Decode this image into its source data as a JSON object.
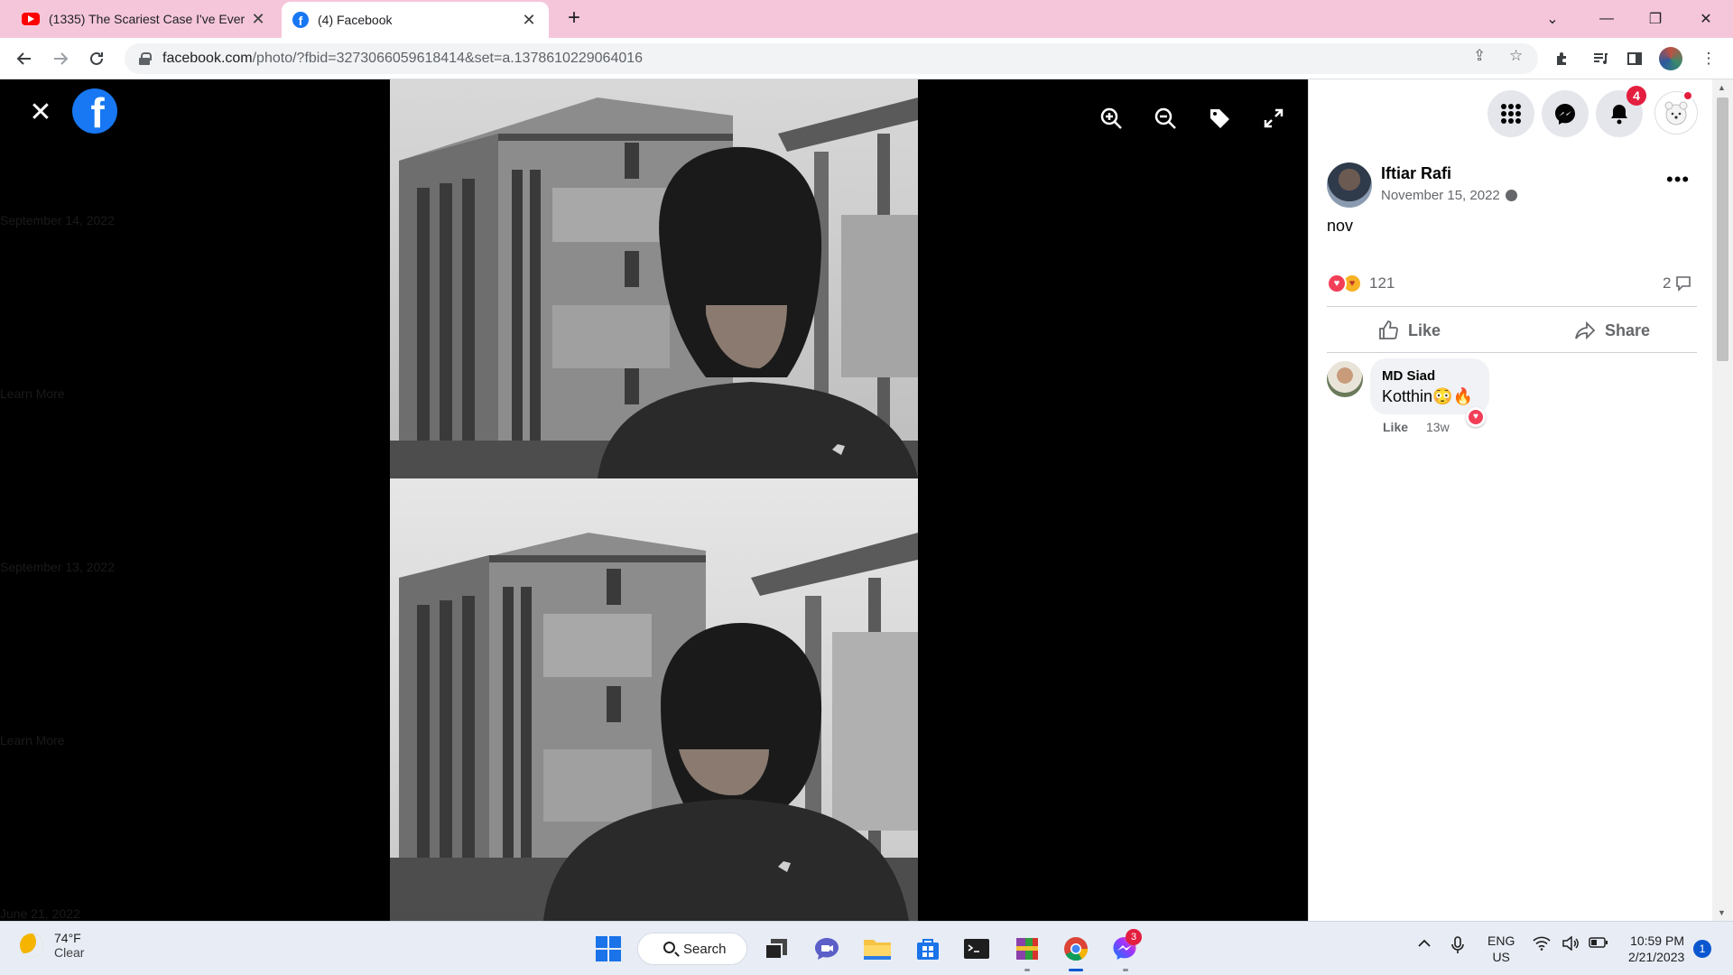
{
  "browser": {
    "tabs": [
      {
        "title": "(1335) The Scariest Case I've Ever Seen",
        "icon": "youtube-icon",
        "active": false
      },
      {
        "title": "(4) Facebook",
        "icon": "facebook-icon",
        "active": true
      }
    ],
    "url": {
      "domain": "facebook.com",
      "path": "/photo/?fbid=3273066059618414&set=a.1378610229064016"
    }
  },
  "viewer": {
    "sidebar_ghost": {
      "date_1": "September 14, 2022",
      "learn_1": "Learn More",
      "date_2": "September 13, 2022",
      "learn_2": "Learn More",
      "date_3": "June 21, 2022"
    },
    "tools": [
      "zoom-in-icon",
      "zoom-out-icon",
      "tag-icon",
      "fullscreen-icon"
    ]
  },
  "header": {
    "notification_count": "4"
  },
  "post": {
    "author": "Iftiar Rafi",
    "date": "November 15, 2022",
    "privacy": "globe-icon",
    "text": "nov",
    "reaction_count": "121",
    "comment_count": "2",
    "actions": {
      "like": "Like",
      "share": "Share"
    }
  },
  "comments": [
    {
      "author": "MD Siad",
      "text": "Kotthin😳🔥",
      "like_label": "Like",
      "time": "13w",
      "reaction": "love"
    }
  ],
  "taskbar": {
    "weather_temp": "74°F",
    "weather_cond": "Clear",
    "search_label": "Search",
    "messenger_badge": "3",
    "lang_1": "ENG",
    "lang_2": "US",
    "time": "10:59 PM",
    "date": "2/21/2023",
    "notification_count": "1"
  },
  "colors": {
    "facebook_blue": "#1877f2",
    "tab_strip": "#f5c6da",
    "badge_red": "#e41e3f"
  }
}
